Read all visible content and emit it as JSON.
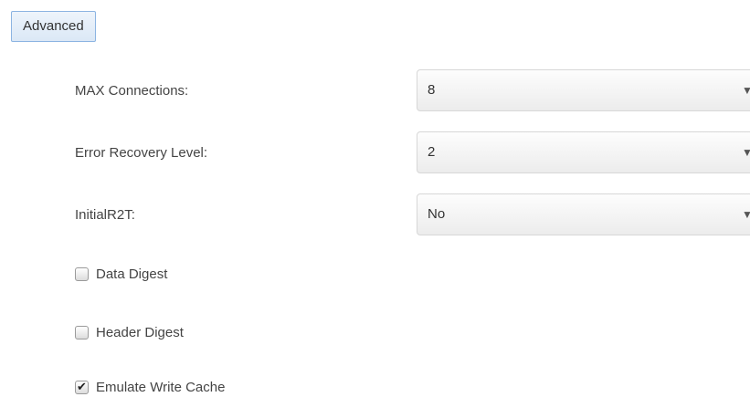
{
  "advanced_button": {
    "label": "Advanced"
  },
  "fields": [
    {
      "label": "MAX Connections:",
      "value": "8",
      "caret_icon": "caret-down-icon",
      "caret_glyph": "▼"
    },
    {
      "label": "Error Recovery Level:",
      "value": "2",
      "caret_icon": "caret-down-icon",
      "caret_glyph": "▼"
    },
    {
      "label": "InitialR2T:",
      "value": "No",
      "caret_icon": "caret-down-icon",
      "caret_glyph": "▼"
    }
  ],
  "checkboxes": [
    {
      "label": "Data Digest",
      "checked": false
    },
    {
      "label": "Header Digest",
      "checked": false
    },
    {
      "label": "Emulate Write Cache",
      "checked": true
    }
  ],
  "check_glyph": "✔",
  "colors": {
    "button_border": "#8cb4e2",
    "text": "#333333",
    "select_border": "#d7d7d7"
  }
}
